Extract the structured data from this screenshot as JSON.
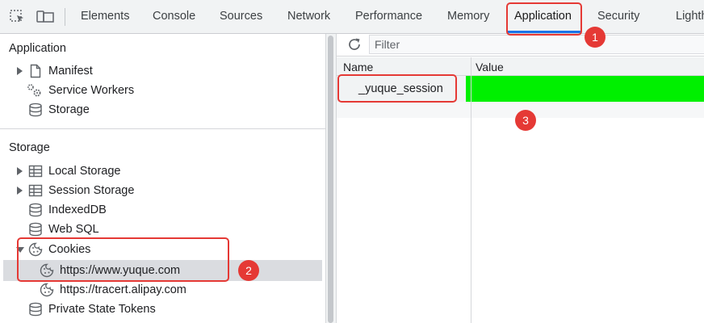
{
  "devtools_tabs": {
    "elements": "Elements",
    "console": "Console",
    "sources": "Sources",
    "network": "Network",
    "performance": "Performance",
    "memory": "Memory",
    "application": "Application",
    "security": "Security",
    "lighthouse": "Lighth"
  },
  "sidebar": {
    "application_title": "Application",
    "application_items": {
      "manifest": "Manifest",
      "service_workers": "Service Workers",
      "storage": "Storage"
    },
    "storage_title": "Storage",
    "storage_items": {
      "local_storage": "Local Storage",
      "session_storage": "Session Storage",
      "indexeddb": "IndexedDB",
      "websql": "Web SQL",
      "cookies": "Cookies",
      "cookie_site_1": "https://www.yuque.com",
      "cookie_site_2": "https://tracert.alipay.com",
      "private_state_tokens": "Private State Tokens"
    }
  },
  "cookies_panel": {
    "filter_placeholder": "Filter",
    "column_name": "Name",
    "column_value": "Value",
    "rows": [
      {
        "name": "_yuque_session",
        "value": ""
      }
    ]
  },
  "annotations": {
    "badge_1": "1",
    "badge_2": "2",
    "badge_3": "3"
  },
  "colors": {
    "accent": "#1a73e8",
    "annotation_red": "#e53935",
    "value_highlight": "#00f000"
  }
}
